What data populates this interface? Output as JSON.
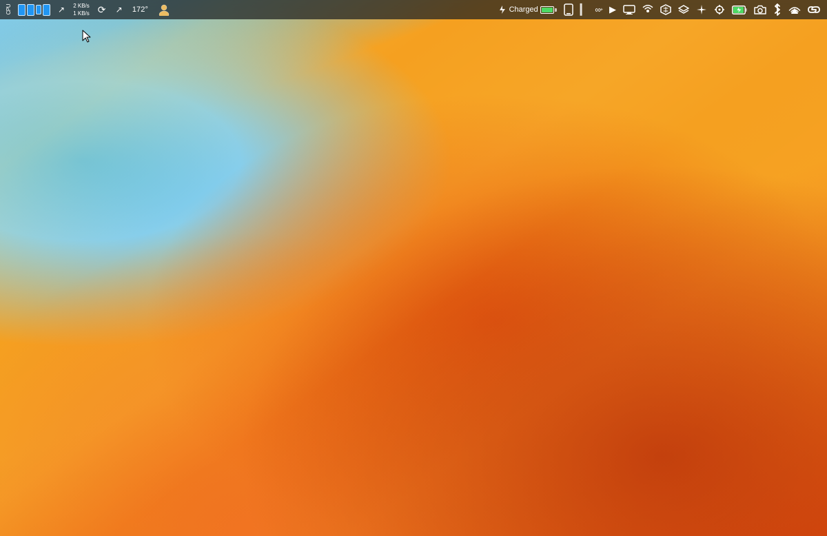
{
  "desktop": {
    "wallpaper": "macOS Ventura golden dunes"
  },
  "menubar": {
    "left": {
      "items": [
        {
          "id": "cpu-monitor",
          "label": "CPU",
          "type": "widget"
        },
        {
          "id": "phone1",
          "label": "phone",
          "type": "device-icon"
        },
        {
          "id": "phone2",
          "label": "phone",
          "type": "device-icon"
        },
        {
          "id": "phone3",
          "label": "phone",
          "type": "device-icon"
        },
        {
          "id": "phone4",
          "label": "phone",
          "type": "device-icon"
        },
        {
          "id": "resize-icon",
          "label": "↗",
          "type": "symbol"
        },
        {
          "id": "network-stats",
          "top": "2 KB/s",
          "bottom": "1 KB/s",
          "type": "stats"
        },
        {
          "id": "refresh-icon",
          "label": "⟳",
          "type": "symbol"
        },
        {
          "id": "resize2-icon",
          "label": "↗",
          "type": "symbol"
        },
        {
          "id": "temp",
          "label": "172°",
          "type": "text"
        },
        {
          "id": "user-avatar",
          "label": "👤",
          "type": "symbol"
        }
      ]
    },
    "right": {
      "items": [
        {
          "id": "battery-section",
          "label": "Charged",
          "type": "battery"
        },
        {
          "id": "phone-icon",
          "label": "📱",
          "type": "symbol"
        },
        {
          "id": "iphone-bar",
          "label": "▌",
          "type": "symbol"
        },
        {
          "id": "infinity",
          "label": "∞+",
          "type": "symbol"
        },
        {
          "id": "play",
          "label": "▶",
          "type": "symbol"
        },
        {
          "id": "display",
          "label": "▭",
          "type": "symbol"
        },
        {
          "id": "airdrop",
          "label": "📡",
          "type": "symbol"
        },
        {
          "id": "xcode",
          "label": "⬡",
          "type": "symbol"
        },
        {
          "id": "layers",
          "label": "⧉",
          "type": "symbol"
        },
        {
          "id": "sparkle",
          "label": "✦",
          "type": "symbol"
        },
        {
          "id": "crosshair",
          "label": "✤",
          "type": "symbol"
        },
        {
          "id": "battery-full",
          "label": "🔋",
          "type": "symbol"
        },
        {
          "id": "camera-icon",
          "label": "⊙",
          "type": "symbol"
        },
        {
          "id": "bluetooth",
          "label": "✲",
          "type": "symbol"
        },
        {
          "id": "airplay-audio",
          "label": "⊳",
          "type": "symbol"
        },
        {
          "id": "link-icon",
          "label": "⌁",
          "type": "symbol"
        }
      ]
    }
  },
  "battery": {
    "status": "Charged",
    "level": 100,
    "charging": true
  }
}
